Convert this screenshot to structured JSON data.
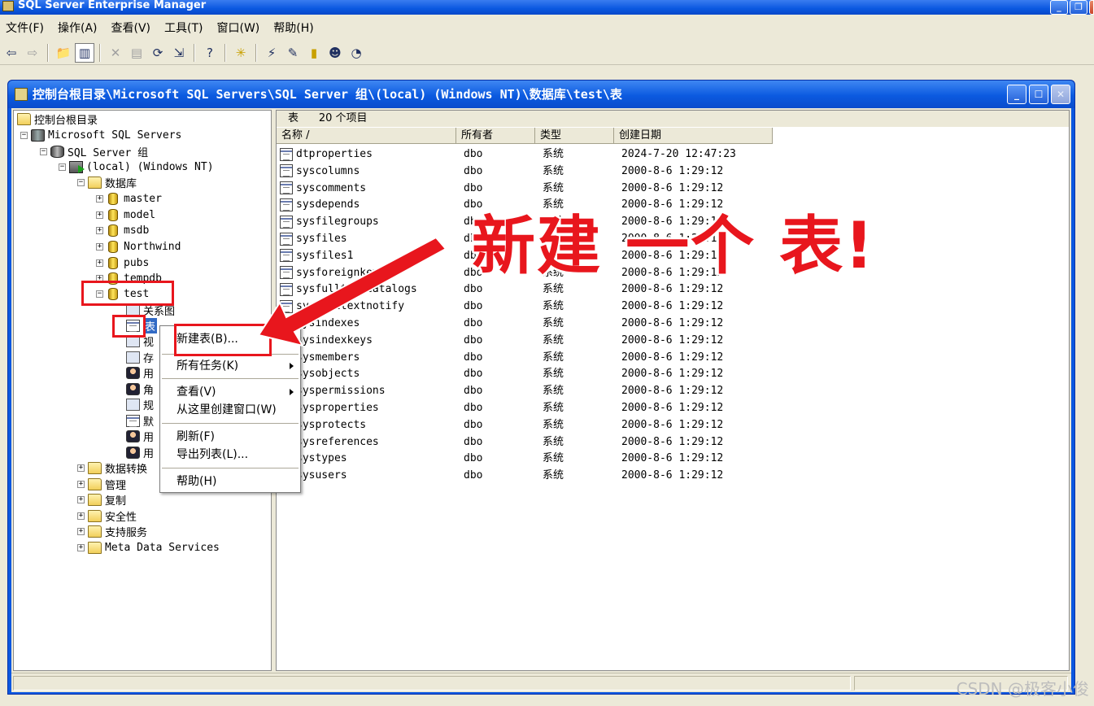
{
  "app": {
    "title": "SQL Server Enterprise Manager"
  },
  "menubar": [
    {
      "label": "文件(F)"
    },
    {
      "label": "操作(A)"
    },
    {
      "label": "查看(V)"
    },
    {
      "label": "工具(T)"
    },
    {
      "label": "窗口(W)"
    },
    {
      "label": "帮助(H)"
    }
  ],
  "toolbar": {
    "icons": [
      "back-arrow-icon",
      "forward-arrow-icon",
      "up-folder-icon",
      "show-hide-tree-icon",
      "delete-icon",
      "properties-icon",
      "refresh-icon",
      "export-list-icon",
      "help-icon",
      "new-icon",
      "wizard-icon",
      "run-query-icon",
      "new-database-icon",
      "new-login-icon",
      "new-job-icon"
    ]
  },
  "child_window": {
    "title": "控制台根目录\\Microsoft SQL Servers\\SQL Server 组\\(local) (Windows NT)\\数据库\\test\\表"
  },
  "tree": {
    "root": "控制台根目录",
    "mss": "Microsoft SQL Servers",
    "group": "SQL Server 组",
    "local": "(local) (Windows NT)",
    "databases": "数据库",
    "master": "master",
    "model": "model",
    "msdb": "msdb",
    "northwind": "Northwind",
    "pubs": "pubs",
    "tempdb": "tempdb",
    "test": "test",
    "diagrams": "关系图",
    "tables": "表",
    "views_short": "视",
    "procs_short": "存",
    "users_short": "用",
    "roles_short": "角",
    "rules_short": "规",
    "defaults_short": "默",
    "udt_short": "用",
    "udf_short": "用",
    "dts": "数据转换",
    "management": "管理",
    "replication": "复制",
    "security": "安全性",
    "support": "支持服务",
    "meta": "Meta Data Services"
  },
  "list": {
    "header_prefix": "表",
    "item_count": "20 个项目",
    "columns": [
      "名称 /",
      "所有者",
      "类型",
      "创建日期"
    ],
    "rows": [
      {
        "name": "dtproperties",
        "owner": "dbo",
        "type": "系统",
        "date": "2024-7-20 12:47:23"
      },
      {
        "name": "syscolumns",
        "owner": "dbo",
        "type": "系统",
        "date": "2000-8-6 1:29:12"
      },
      {
        "name": "syscomments",
        "owner": "dbo",
        "type": "系统",
        "date": "2000-8-6 1:29:12"
      },
      {
        "name": "sysdepends",
        "owner": "dbo",
        "type": "系统",
        "date": "2000-8-6 1:29:12"
      },
      {
        "name": "sysfilegroups",
        "owner": "dbo",
        "type": "系统",
        "date": "2000-8-6 1:29:12"
      },
      {
        "name": "sysfiles",
        "owner": "dbo",
        "type": "系统",
        "date": "2000-8-6 1:29:12"
      },
      {
        "name": "sysfiles1",
        "owner": "dbo",
        "type": "系统",
        "date": "2000-8-6 1:29:12"
      },
      {
        "name": "sysforeignkeys",
        "owner": "dbo",
        "type": "系统",
        "date": "2000-8-6 1:29:12"
      },
      {
        "name": "sysfulltextcatalogs",
        "owner": "dbo",
        "type": "系统",
        "date": "2000-8-6 1:29:12"
      },
      {
        "name": "sysfulltextnotify",
        "owner": "dbo",
        "type": "系统",
        "date": "2000-8-6 1:29:12"
      },
      {
        "name": "sysindexes",
        "owner": "dbo",
        "type": "系统",
        "date": "2000-8-6 1:29:12"
      },
      {
        "name": "sysindexkeys",
        "owner": "dbo",
        "type": "系统",
        "date": "2000-8-6 1:29:12"
      },
      {
        "name": "sysmembers",
        "owner": "dbo",
        "type": "系统",
        "date": "2000-8-6 1:29:12"
      },
      {
        "name": "sysobjects",
        "owner": "dbo",
        "type": "系统",
        "date": "2000-8-6 1:29:12"
      },
      {
        "name": "syspermissions",
        "owner": "dbo",
        "type": "系统",
        "date": "2000-8-6 1:29:12"
      },
      {
        "name": "sysproperties",
        "owner": "dbo",
        "type": "系统",
        "date": "2000-8-6 1:29:12"
      },
      {
        "name": "sysprotects",
        "owner": "dbo",
        "type": "系统",
        "date": "2000-8-6 1:29:12"
      },
      {
        "name": "sysreferences",
        "owner": "dbo",
        "type": "系统",
        "date": "2000-8-6 1:29:12"
      },
      {
        "name": "systypes",
        "owner": "dbo",
        "type": "系统",
        "date": "2000-8-6 1:29:12"
      },
      {
        "name": "sysusers",
        "owner": "dbo",
        "type": "系统",
        "date": "2000-8-6 1:29:12"
      }
    ]
  },
  "context_menu": {
    "new_table": "新建表(B)...",
    "all_tasks": "所有任务(K)",
    "view": "查看(V)",
    "new_window": "从这里创建窗口(W)",
    "refresh": "刷新(F)",
    "export": "导出列表(L)...",
    "help": "帮助(H)"
  },
  "annotation": {
    "text": "新建 一个 表!",
    "color": "#e8161d"
  },
  "watermark": "CSDN @极客小俊",
  "colors": {
    "titlebar": "#0a57e0",
    "selection": "#316ac5",
    "chrome": "#ece9d8"
  }
}
